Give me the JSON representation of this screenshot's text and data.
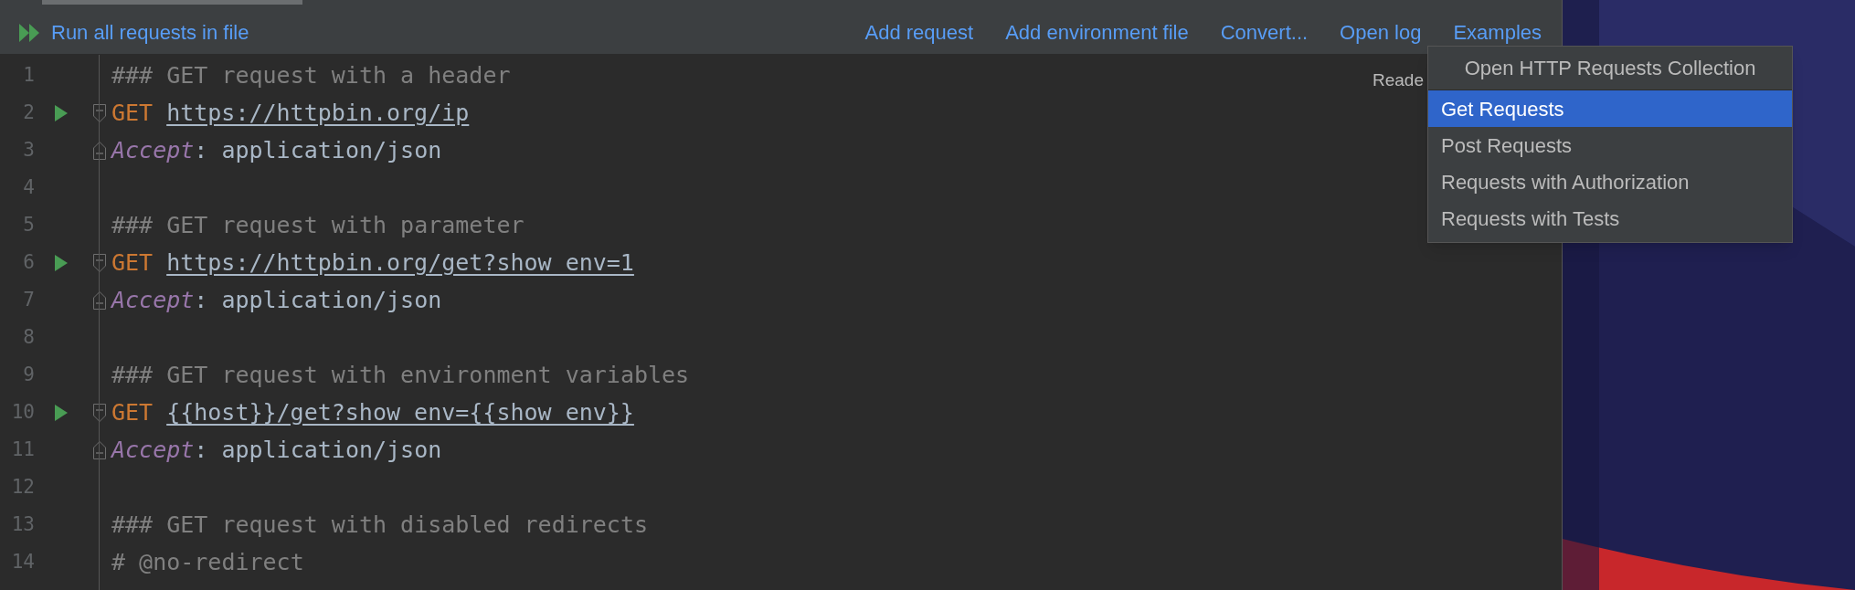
{
  "toolbar": {
    "run_all": "Run all requests in file",
    "actions": [
      "Add request",
      "Add environment file",
      "Convert...",
      "Open log",
      "Examples"
    ]
  },
  "editor": {
    "reader_hint": "Reade",
    "lines": [
      {
        "number": "1",
        "run": false,
        "fold_start": false,
        "fold_end": false,
        "tokens": [
          {
            "kind": "comment",
            "text": "### GET request with a header"
          }
        ]
      },
      {
        "number": "2",
        "run": true,
        "fold_start": true,
        "fold_end": false,
        "tokens": [
          {
            "kind": "method",
            "text": "GET"
          },
          {
            "kind": "url",
            "text": "https://httpbin.org/ip"
          }
        ]
      },
      {
        "number": "3",
        "run": false,
        "fold_start": false,
        "fold_end": true,
        "tokens": [
          {
            "kind": "header",
            "text": "Accept"
          },
          {
            "kind": "plain",
            "text": ": application/json"
          }
        ]
      },
      {
        "number": "4",
        "run": false,
        "fold_start": false,
        "fold_end": false
      },
      {
        "number": "5",
        "run": false,
        "fold_start": false,
        "fold_end": false,
        "tokens": [
          {
            "kind": "comment",
            "text": "### GET request with parameter"
          }
        ]
      },
      {
        "number": "6",
        "run": true,
        "fold_start": true,
        "fold_end": false,
        "tokens": [
          {
            "kind": "method",
            "text": "GET"
          },
          {
            "kind": "url",
            "text": "https://httpbin.org/get?show_env=1"
          }
        ]
      },
      {
        "number": "7",
        "run": false,
        "fold_start": false,
        "fold_end": true,
        "tokens": [
          {
            "kind": "header",
            "text": "Accept"
          },
          {
            "kind": "plain",
            "text": ": application/json"
          }
        ]
      },
      {
        "number": "8",
        "run": false,
        "fold_start": false,
        "fold_end": false
      },
      {
        "number": "9",
        "run": false,
        "fold_start": false,
        "fold_end": false,
        "tokens": [
          {
            "kind": "comment",
            "text": "### GET request with environment variables"
          }
        ]
      },
      {
        "number": "10",
        "run": true,
        "fold_start": true,
        "fold_end": false,
        "tokens": [
          {
            "kind": "method",
            "text": "GET"
          },
          {
            "kind": "url",
            "text": "{{host}}/get?show_env={{show_env}}"
          }
        ]
      },
      {
        "number": "11",
        "run": false,
        "fold_start": false,
        "fold_end": true,
        "tokens": [
          {
            "kind": "header",
            "text": "Accept"
          },
          {
            "kind": "plain",
            "text": ": application/json"
          }
        ]
      },
      {
        "number": "12",
        "run": false,
        "fold_start": false,
        "fold_end": false
      },
      {
        "number": "13",
        "run": false,
        "fold_start": false,
        "fold_end": false,
        "tokens": [
          {
            "kind": "comment",
            "text": "### GET request with disabled redirects"
          }
        ]
      },
      {
        "number": "14",
        "run": false,
        "fold_start": false,
        "fold_end": false,
        "tokens": [
          {
            "kind": "comment",
            "text": "# @no-redirect"
          }
        ]
      }
    ]
  },
  "menu": {
    "header": "Open HTTP Requests Collection",
    "items": [
      {
        "label": "Get Requests",
        "selected": true
      },
      {
        "label": "Post Requests",
        "selected": false
      },
      {
        "label": "Requests with Authorization",
        "selected": false
      },
      {
        "label": "Requests with Tests",
        "selected": false
      }
    ]
  }
}
